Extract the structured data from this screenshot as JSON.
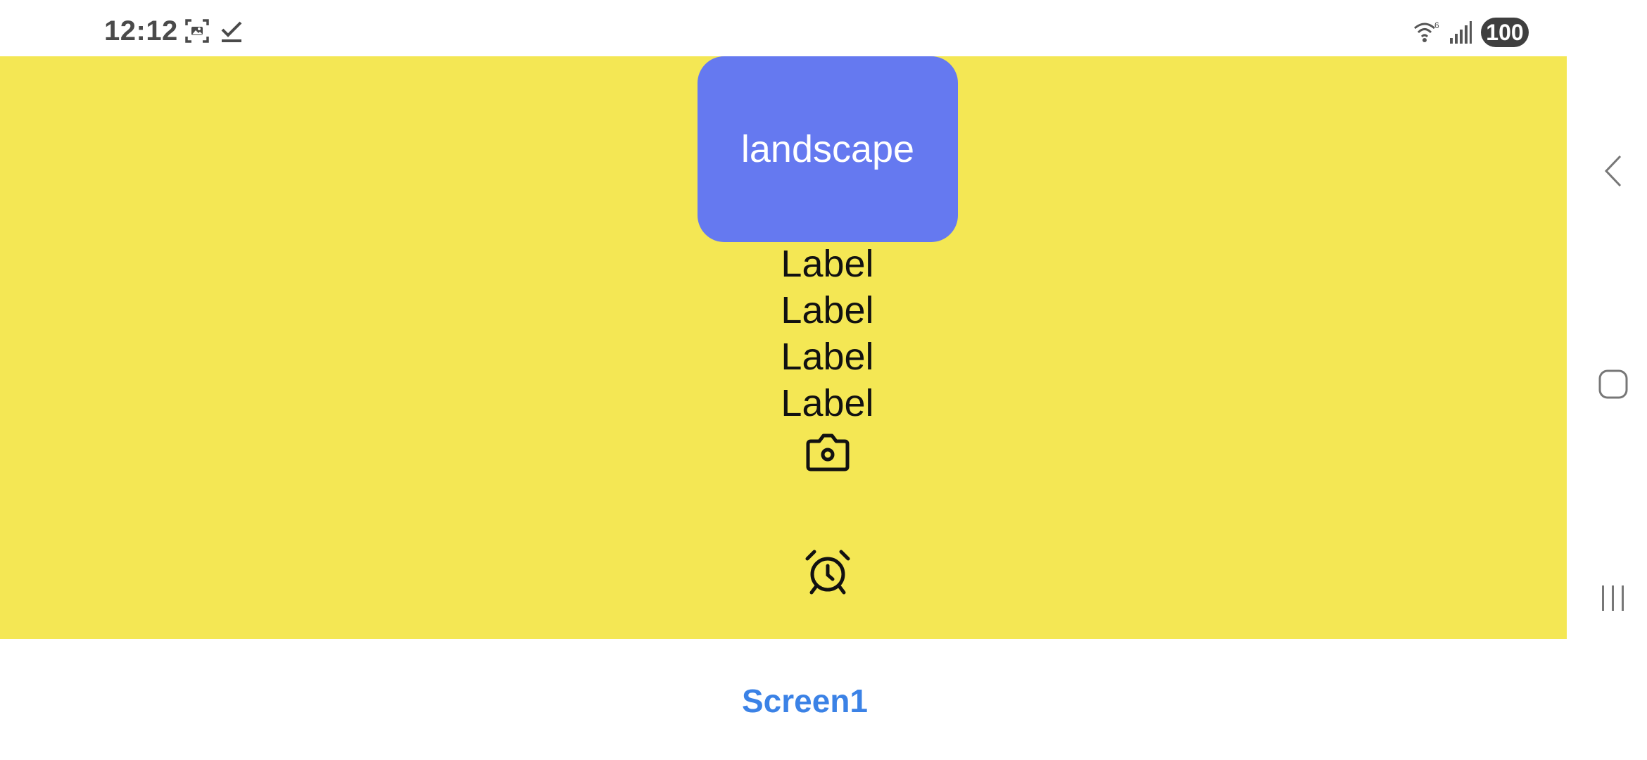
{
  "status_bar": {
    "time": "12:12",
    "icons": [
      "screenshot-icon",
      "check-icon",
      "wifi-icon",
      "signal-icon"
    ],
    "battery": "100"
  },
  "app": {
    "background_color": "#f4e754",
    "button": {
      "label": "landscape",
      "color": "#6579f0"
    },
    "labels": [
      "Label",
      "Label",
      "Label",
      "Label"
    ],
    "icons": [
      "camera-icon",
      "alarm-icon"
    ]
  },
  "footer": {
    "screen_title": "Screen1",
    "title_color": "#3b82e6"
  },
  "navigation": {
    "buttons": [
      "back",
      "home",
      "recents"
    ]
  }
}
